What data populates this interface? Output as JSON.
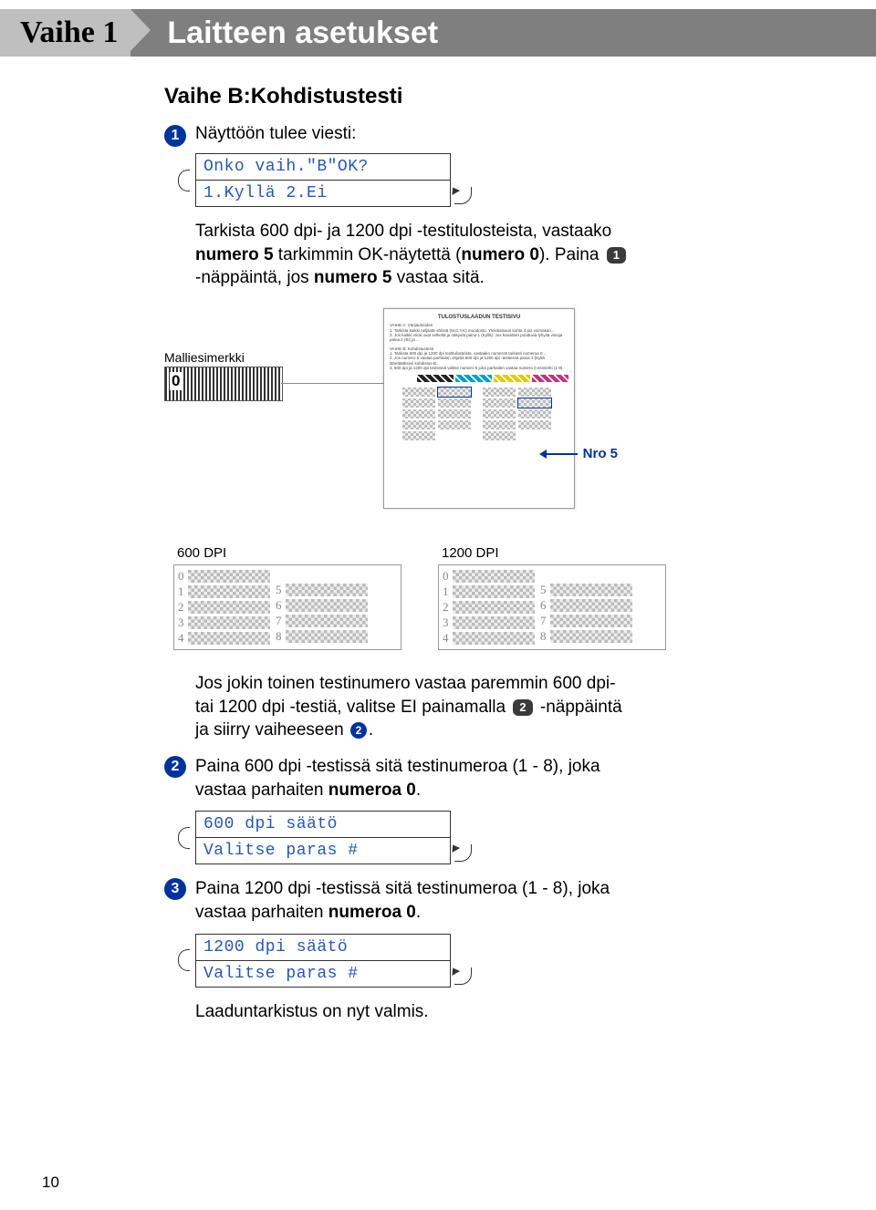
{
  "header": {
    "tab": "Vaihe 1",
    "title": "Laitteen asetukset"
  },
  "section_b_title": "Vaihe B:Kohdistustesti",
  "steps": {
    "s1": {
      "num": "1",
      "intro": "Näyttöön tulee viesti:",
      "lcd": {
        "line1": "Onko vaih.\"B\"OK?",
        "line2": "1.Kyllä 2.Ei"
      },
      "para1a": "Tarkista 600 dpi- ja 1200 dpi -testitulosteista, vastaako ",
      "para1b": "numero 5",
      "para1c": " tarkimmin OK-näytettä (",
      "para1d": "numero 0",
      "para1e": "). Paina",
      "key1": "1",
      "para1f": " -näppäintä, jos ",
      "para1g": "numero 5",
      "para1h": " vastaa sitä.",
      "sample_label": "Malliesimerkki",
      "sample_zero": "0",
      "sheet_title": "TULOSTUSLAADUN TESTISIVU",
      "nro5": "Nro 5",
      "dpi600": "600 DPI",
      "dpi1200": "1200 DPI",
      "para2a": "Jos jokin toinen testinumero vastaa paremmin 600 dpi- tai 1200 dpi -testiä, valitse EI painamalla ",
      "key2": "2",
      "para2b": " -näppäintä ja siirry vaiheeseen ",
      "ref2": "2",
      "para2c": "."
    },
    "s2": {
      "num": "2",
      "text1": "Paina 600 dpi -testissä sitä testinumeroa (1 - 8), joka vastaa parhaiten ",
      "bold": "numeroa 0",
      "text2": ".",
      "lcd": {
        "line1": "600 dpi säätö",
        "line2": "Valitse paras #"
      }
    },
    "s3": {
      "num": "3",
      "text1": "Paina 1200 dpi -testissä sitä testinumeroa (1 - 8), joka vastaa parhaiten ",
      "bold": "numeroa 0",
      "text2": ".",
      "lcd": {
        "line1": "1200 dpi säätö",
        "line2": "Valitse paras #"
      },
      "done": "Laaduntarkistus on nyt valmis."
    }
  },
  "dpi_numbers_left": [
    "0",
    "1",
    "2",
    "3",
    "4"
  ],
  "dpi_numbers_right": [
    "5",
    "6",
    "7",
    "8"
  ],
  "page_number": "10"
}
